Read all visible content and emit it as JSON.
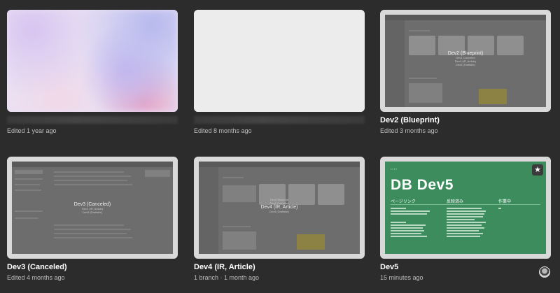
{
  "cards": [
    {
      "title": "",
      "meta": "Edited 1 year ago"
    },
    {
      "title": "",
      "meta": "Edited 8 months ago"
    },
    {
      "title": "Dev2 (Blueprint)",
      "meta": "Edited 3 months ago",
      "overlay": {
        "name": "Dev2 (Blueprint)",
        "lines": [
          "Dev1 Canceled",
          "Dev3 (IR, Article)",
          "Dev5 (Draftsite)"
        ]
      }
    },
    {
      "title": "Dev3 (Canceled)",
      "meta": "Edited 4 months ago",
      "overlay": {
        "name": "Dev3 (Canceled)",
        "lines": [
          "Dev2 (IR, Article)",
          "Dev5 (Draftsite)"
        ]
      }
    },
    {
      "title": "Dev4 (IR, Article)",
      "meta": "1 branch · 1 month ago",
      "overlay": {
        "name": "Dev4 (IR, Article)",
        "lines": [
          "Dev2 Blueprint",
          "Dev3 Canceled",
          "Dev5 (Draftsite)"
        ]
      }
    },
    {
      "title": "Dev5",
      "meta": "15 minutes ago",
      "slide": {
        "heading": "DB Dev5",
        "col1": "ページリンク",
        "col2": "反映済み",
        "col3": "作業中"
      }
    }
  ],
  "icons": {
    "star": "star-icon",
    "avatar": "user-avatar"
  },
  "colors": {
    "background": "#2c2c2c",
    "slide_green": "#3d8c5e"
  }
}
